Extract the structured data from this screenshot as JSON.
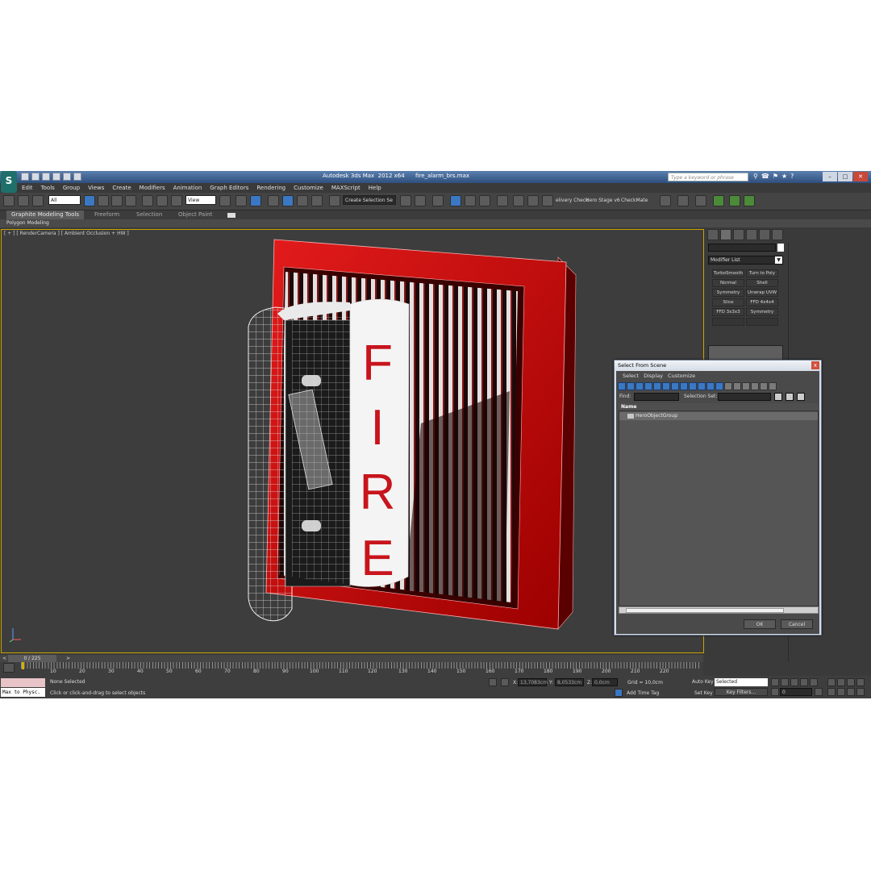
{
  "window": {
    "title": "Autodesk 3ds Max  2012 x64      fire_alarm_brs.max",
    "search_placeholder": "Type a keyword or phrase",
    "app_logo": "S"
  },
  "menu": [
    "Edit",
    "Tools",
    "Group",
    "Views",
    "Create",
    "Modifiers",
    "Animation",
    "Graph Editors",
    "Rendering",
    "Customize",
    "MAXScript",
    "Help"
  ],
  "toolbar": {
    "filter_value": "All",
    "refcoord_value": "View",
    "selection_set_value": "Create Selection Se",
    "plugin_labels": [
      "elivery Check",
      "Hero Stage v6",
      "CheckMate"
    ]
  },
  "ribbon": {
    "tabs": [
      "Graphite Modeling Tools",
      "Freeform",
      "Selection",
      "Object Paint"
    ],
    "panel_label": "Polygon Modeling"
  },
  "viewport": {
    "label": "[ + ] [ RenderCamera ] [ Ambient Occlusion + HW ]",
    "scene_text": [
      "F",
      "I",
      "R",
      "E"
    ]
  },
  "command_panel": {
    "modifier_list_label": "Modifier List",
    "modifier_buttons": [
      "TurboSmooth",
      "Turn to Poly",
      "Normal",
      "Shell",
      "Symmetry",
      "Unwrap UVW",
      "Slice",
      "FFD 4x4x4",
      "FFD 3x3x3",
      "Symmetry",
      "",
      ""
    ]
  },
  "dialog": {
    "title": "Select From Scene",
    "close": "x",
    "menu": [
      "Select",
      "Display",
      "Customize"
    ],
    "find_label": "Find:",
    "selection_set_label": "Selection Set:",
    "column_name": "Name",
    "items": [
      "HeroObjectGroup"
    ],
    "ok": "OK",
    "cancel": "Cancel"
  },
  "timeline": {
    "slider_label": "0 / 225",
    "ticks": [
      "10",
      "20",
      "30",
      "40",
      "50",
      "60",
      "70",
      "80",
      "90",
      "100",
      "110",
      "120",
      "130",
      "140",
      "150",
      "160",
      "170",
      "180",
      "190",
      "200",
      "210",
      "220"
    ]
  },
  "status": {
    "maxscript_text": "Max to Physc.",
    "selection": "None Selected",
    "prompt": "Click or click-and-drag to select objects",
    "x_label": "X:",
    "x_value": "13,7083cm",
    "y_label": "Y:",
    "y_value": "8,0533cm",
    "z_label": "Z:",
    "z_value": "0,0cm",
    "grid": "Grid = 10,0cm",
    "add_time_tag": "Add Time Tag",
    "auto_key": "Auto Key",
    "set_key": "Set Key",
    "selected_combo": "Selected",
    "key_filters": "Key Filters...",
    "frame_value": "0"
  }
}
